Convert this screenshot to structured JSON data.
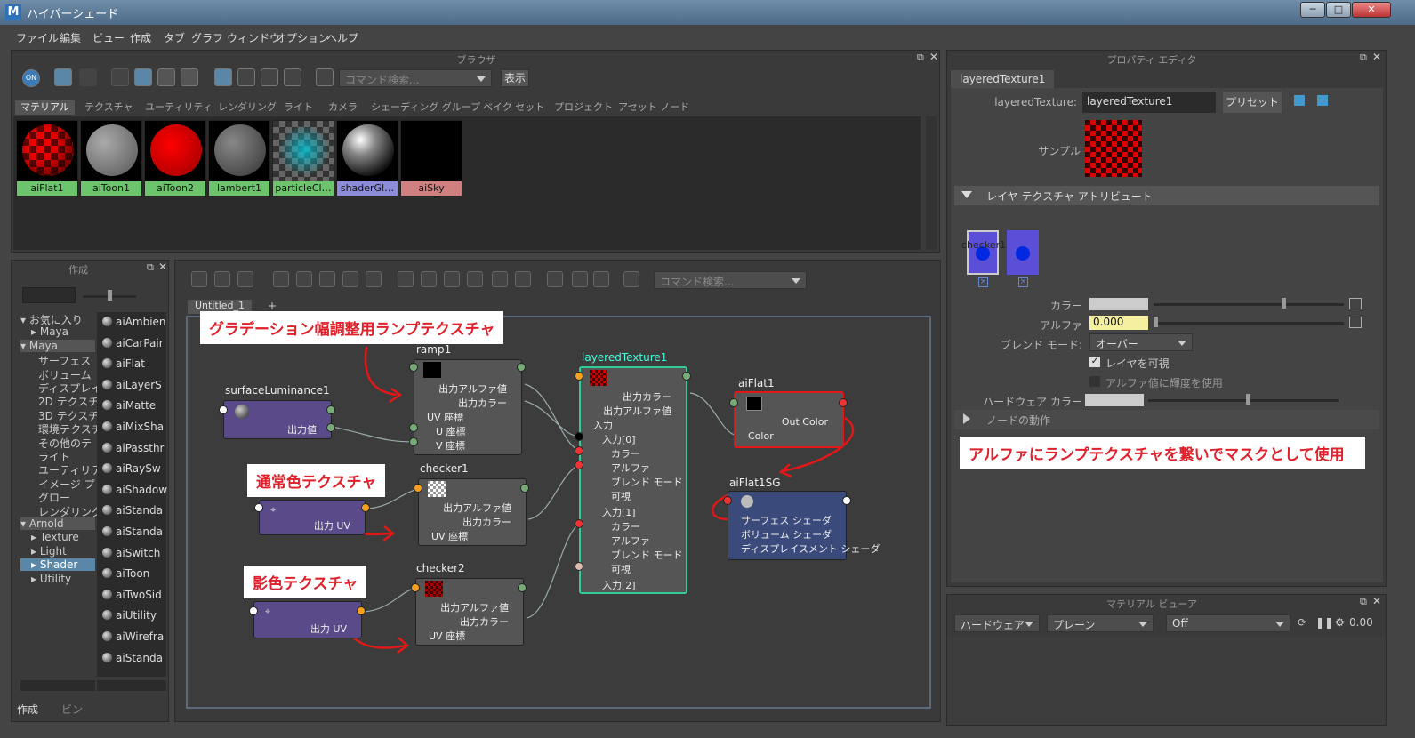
{
  "window": {
    "title": "ハイパーシェード",
    "min": "─",
    "max": "□",
    "close": "✕"
  },
  "menu": [
    "ファイル",
    "編集",
    "ビュー",
    "作成",
    "タブ",
    "グラフ",
    "ウィンドウ",
    "オプション",
    "ヘルプ"
  ],
  "browser": {
    "title": "ブラウザ",
    "search_placeholder": "コマンド検索...",
    "show_button": "表示",
    "on_label": "ON",
    "tabs": [
      "マテリアル",
      "テクスチャ",
      "ユーティリティ",
      "レンダリング",
      "ライト",
      "カメラ",
      "シェーディング グループ",
      "ベイク セット",
      "プロジェクト",
      "アセット ノード"
    ],
    "swatches": [
      {
        "label": "aiFlat1",
        "color": "#6cc46c"
      },
      {
        "label": "aiToon1",
        "color": "#6cc46c"
      },
      {
        "label": "aiToon2",
        "color": "#6cc46c"
      },
      {
        "label": "lambert1",
        "color": "#6cc46c"
      },
      {
        "label": "particleCl…",
        "color": "#6cc46c"
      },
      {
        "label": "shaderGl…",
        "color": "#8c8cd8"
      },
      {
        "label": "aiSky",
        "color": "#d08080"
      }
    ]
  },
  "create": {
    "title": "作成",
    "tree": [
      {
        "label": "お気に入り",
        "type": "open"
      },
      {
        "label": "Maya",
        "type": "child"
      },
      {
        "label": "Maya",
        "type": "openhl"
      },
      {
        "label": "サーフェス",
        "type": "leaf"
      },
      {
        "label": "ボリューム",
        "type": "leaf"
      },
      {
        "label": "ディスプレイ",
        "type": "leaf"
      },
      {
        "label": "2D テクスチ",
        "type": "leaf"
      },
      {
        "label": "3D テクスチ",
        "type": "leaf"
      },
      {
        "label": "環境テクスチ",
        "type": "leaf"
      },
      {
        "label": "その他のテ",
        "type": "leaf"
      },
      {
        "label": "ライト",
        "type": "leaf"
      },
      {
        "label": "ユーティリテ",
        "type": "leaf"
      },
      {
        "label": "イメージ プ",
        "type": "leaf"
      },
      {
        "label": "グロー",
        "type": "leaf"
      },
      {
        "label": "レンダリング",
        "type": "leaf"
      },
      {
        "label": "Arnold",
        "type": "openhl"
      },
      {
        "label": "Texture",
        "type": "child"
      },
      {
        "label": "Light",
        "type": "child"
      },
      {
        "label": "Shader",
        "type": "sel"
      },
      {
        "label": "Utility",
        "type": "child"
      }
    ],
    "list": [
      "aiAmbien",
      "aiCarPair",
      "aiFlat",
      "aiLayerS",
      "aiMatte",
      "aiMixSha",
      "aiPassthr",
      "aiRaySw",
      "aiShadow",
      "aiStanda",
      "aiStanda",
      "aiSwitch",
      "aiToon",
      "aiTwoSid",
      "aiUtility",
      "aiWirefra",
      "aiStanda"
    ],
    "bottom_tabs": [
      "作成",
      "ビン"
    ]
  },
  "graph": {
    "search_placeholder": "コマンド検索...",
    "tab": "Untitled_1",
    "tab_add": "+",
    "nodes": {
      "surfaceLuminance": {
        "title": "surfaceLuminance1",
        "out": "出力値"
      },
      "ramp": {
        "title": "ramp1",
        "rows": [
          "出力アルファ値",
          "出力カラー",
          "UV 座標",
          "U 座標",
          "V 座標"
        ]
      },
      "checker1": {
        "title": "checker1",
        "rows": [
          "出力アルファ値",
          "出力カラー",
          "UV 座標"
        ]
      },
      "checker2": {
        "title": "checker2",
        "rows": [
          "出力アルファ値",
          "出力カラー",
          "UV 座標"
        ]
      },
      "place1": {
        "out": "出力 UV"
      },
      "place2": {
        "out": "出力 UV"
      },
      "layered": {
        "title": "layeredTexture1",
        "rows": [
          "出力カラー",
          "出力アルファ値",
          "入力",
          "入力[0]",
          "カラー",
          "アルファ",
          "ブレンド モード",
          "可視",
          "入力[1]",
          "カラー",
          "アルファ",
          "ブレンド モード",
          "可視",
          "入力[2]"
        ]
      },
      "aiFlat": {
        "title": "aiFlat1",
        "rows": [
          "Out Color",
          "Color"
        ]
      },
      "sg": {
        "title": "aiFlat1SG",
        "rows": [
          "サーフェス シェーダ",
          "ボリューム シェーダ",
          "ディスプレイスメント シェーダ"
        ]
      }
    },
    "callouts": [
      "グラデーション幅調整用ランプテクスチャ",
      "通常色テクスチャ",
      "影色テクスチャ"
    ]
  },
  "props": {
    "title": "プロパティ エディタ",
    "tab": "layeredTexture1",
    "type_label": "layeredTexture:",
    "name_value": "layeredTexture1",
    "preset": "プリセット",
    "sample_label": "サンプル",
    "section": "レイヤ テクスチャ アトリビュート",
    "layer_name": "checker1",
    "color_label": "カラー",
    "alpha_label": "アルファ",
    "alpha_value": "0.000",
    "alpha_fraction": 0,
    "blend_label": "ブレンド モード:",
    "blend_value": "オーバー",
    "visible_label": "レイヤを可視",
    "alpha_lum_label": "アルファ値に輝度を使用",
    "hw_color_label": "ハードウェア カラー",
    "node_behavior": "ノードの動作",
    "callout": "アルファにランプテクスチャを繋いでマスクとして使用"
  },
  "viewer": {
    "title": "マテリアル ビューア",
    "renderer": "ハードウェア",
    "object": "プレーン",
    "mode": "Off",
    "value": "0.00"
  }
}
